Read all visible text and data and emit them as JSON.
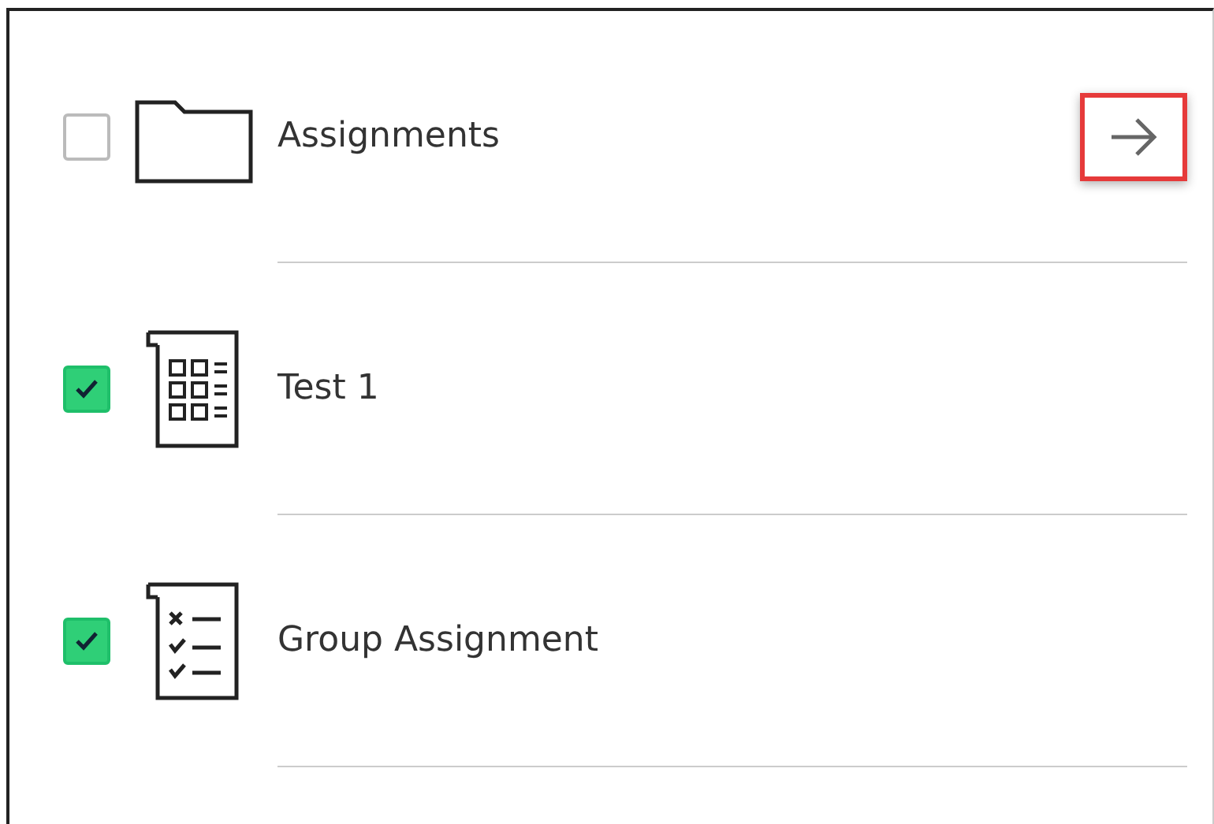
{
  "items": [
    {
      "kind": "folder",
      "label": "Assignments",
      "checked": false,
      "arrow": {
        "highlighted": true
      }
    },
    {
      "kind": "test",
      "label": "Test 1",
      "checked": true
    },
    {
      "kind": "assignment",
      "label": "Group Assignment",
      "checked": true
    }
  ]
}
